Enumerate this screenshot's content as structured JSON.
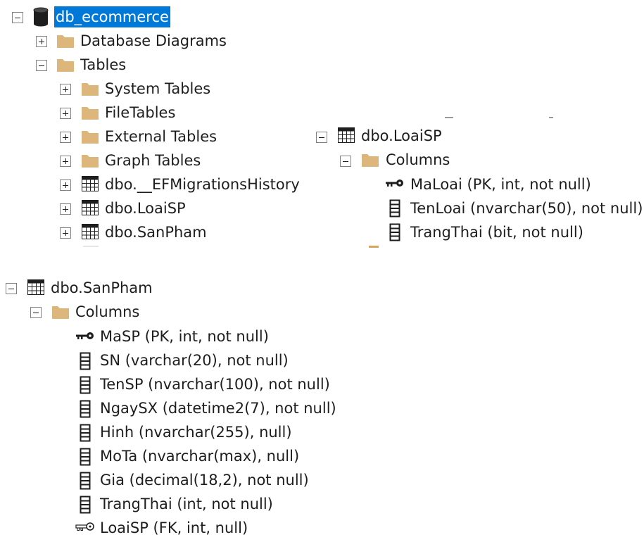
{
  "tree1": {
    "database": "db_ecommerce",
    "database_diagrams": "Database Diagrams",
    "tables": "Tables",
    "system_tables": "System Tables",
    "file_tables": "FileTables",
    "external_tables": "External Tables",
    "graph_tables": "Graph Tables",
    "t_ef": "dbo.__EFMigrationsHistory",
    "t_loaisp": "dbo.LoaiSP",
    "t_sanpham": "dbo.SanPham"
  },
  "tree2": {
    "table": "dbo.LoaiSP",
    "columns": "Columns",
    "cols": [
      "MaLoai (PK, int, not null)",
      "TenLoai (nvarchar(50), not null)",
      "TrangThai (bit, not null)"
    ]
  },
  "tree3": {
    "table": "dbo.SanPham",
    "columns": "Columns",
    "cols": [
      "MaSP (PK, int, not null)",
      "SN (varchar(20), not null)",
      "TenSP (nvarchar(100), not null)",
      "NgaySX (datetime2(7), not null)",
      "Hinh (nvarchar(255), null)",
      "MoTa (nvarchar(max), null)",
      "Gia (decimal(18,2), not null)",
      "TrangThai (int, not null)",
      "LoaiSP (FK, int, null)"
    ]
  },
  "icons": {
    "folder_color": "#dcb67a",
    "selection_color": "#0078d7"
  }
}
